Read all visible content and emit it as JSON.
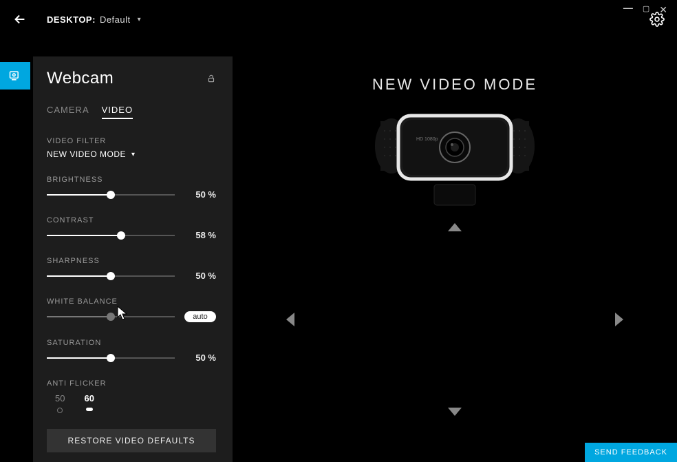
{
  "window": {
    "minimize": "—",
    "maximize": "▢",
    "close": "✕"
  },
  "header": {
    "desktop_prefix": "DESKTOP:",
    "desktop_value": "Default"
  },
  "panel": {
    "title": "Webcam",
    "tabs": {
      "camera": "CAMERA",
      "video": "VIDEO"
    },
    "filter_label": "VIDEO FILTER",
    "filter_value": "NEW VIDEO MODE",
    "sliders": {
      "brightness": {
        "label": "BRIGHTNESS",
        "value": "50 %",
        "percent": 50
      },
      "contrast": {
        "label": "CONTRAST",
        "value": "58 %",
        "percent": 58
      },
      "sharpness": {
        "label": "SHARPNESS",
        "value": "50 %",
        "percent": 50
      },
      "whitebalance": {
        "label": "WHITE BALANCE",
        "auto": "auto",
        "percent": 50
      },
      "saturation": {
        "label": "SATURATION",
        "value": "50 %",
        "percent": 50
      }
    },
    "antiflicker": {
      "label": "ANTI FLICKER",
      "opt50": "50",
      "opt60": "60"
    },
    "restore": "RESTORE VIDEO DEFAULTS"
  },
  "main": {
    "mode_title": "NEW VIDEO MODE"
  },
  "feedback": "SEND FEEDBACK"
}
